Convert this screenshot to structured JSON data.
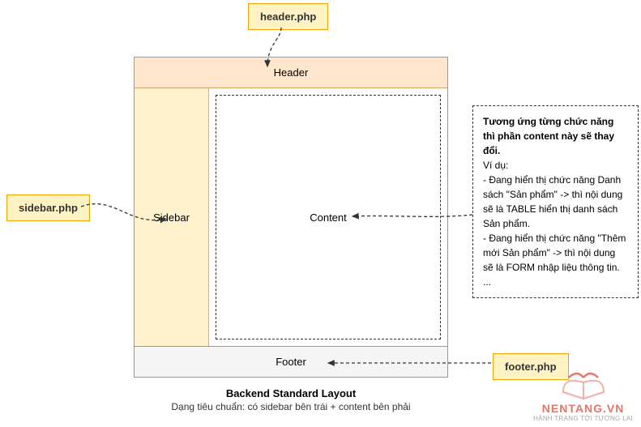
{
  "labels": {
    "header_php": "header.php",
    "sidebar_php": "sidebar.php",
    "footer_php": "footer.php"
  },
  "layout": {
    "header": "Header",
    "sidebar": "Sidebar",
    "content": "Content",
    "footer": "Footer"
  },
  "note": {
    "bold_line": "Tương ứng từng chức năng thì phần content này sẽ thay đổi.",
    "line_intro": "Ví dụ:",
    "line1": "- Đang hiển thị chức năng Danh sách \"Sản phẩm\" -> thì nội dung sẽ là TABLE hiển thị danh sách Sản phẩm.",
    "line2": "- Đang hiển thị chức năng \"Thêm mới Sản phẩm\" -> thì nội dung sẽ là FORM nhập liệu thông tin.",
    "line3": "..."
  },
  "caption": {
    "title": "Backend Standard Layout",
    "subtitle": "Dạng tiêu chuẩn: có sidebar bên trái + content bên phải"
  },
  "watermark": {
    "brand": "NENTANG.VN",
    "tagline": "HÀNH TRANG TỚI TƯƠNG LAI"
  },
  "colors": {
    "label_bg": "#fff3c4",
    "label_border": "#f0a500",
    "header_bg": "#ffe6cc",
    "sidebar_bg": "#fff2cc",
    "footer_bg": "#f5f5f5",
    "watermark_red": "#d94a3a"
  }
}
